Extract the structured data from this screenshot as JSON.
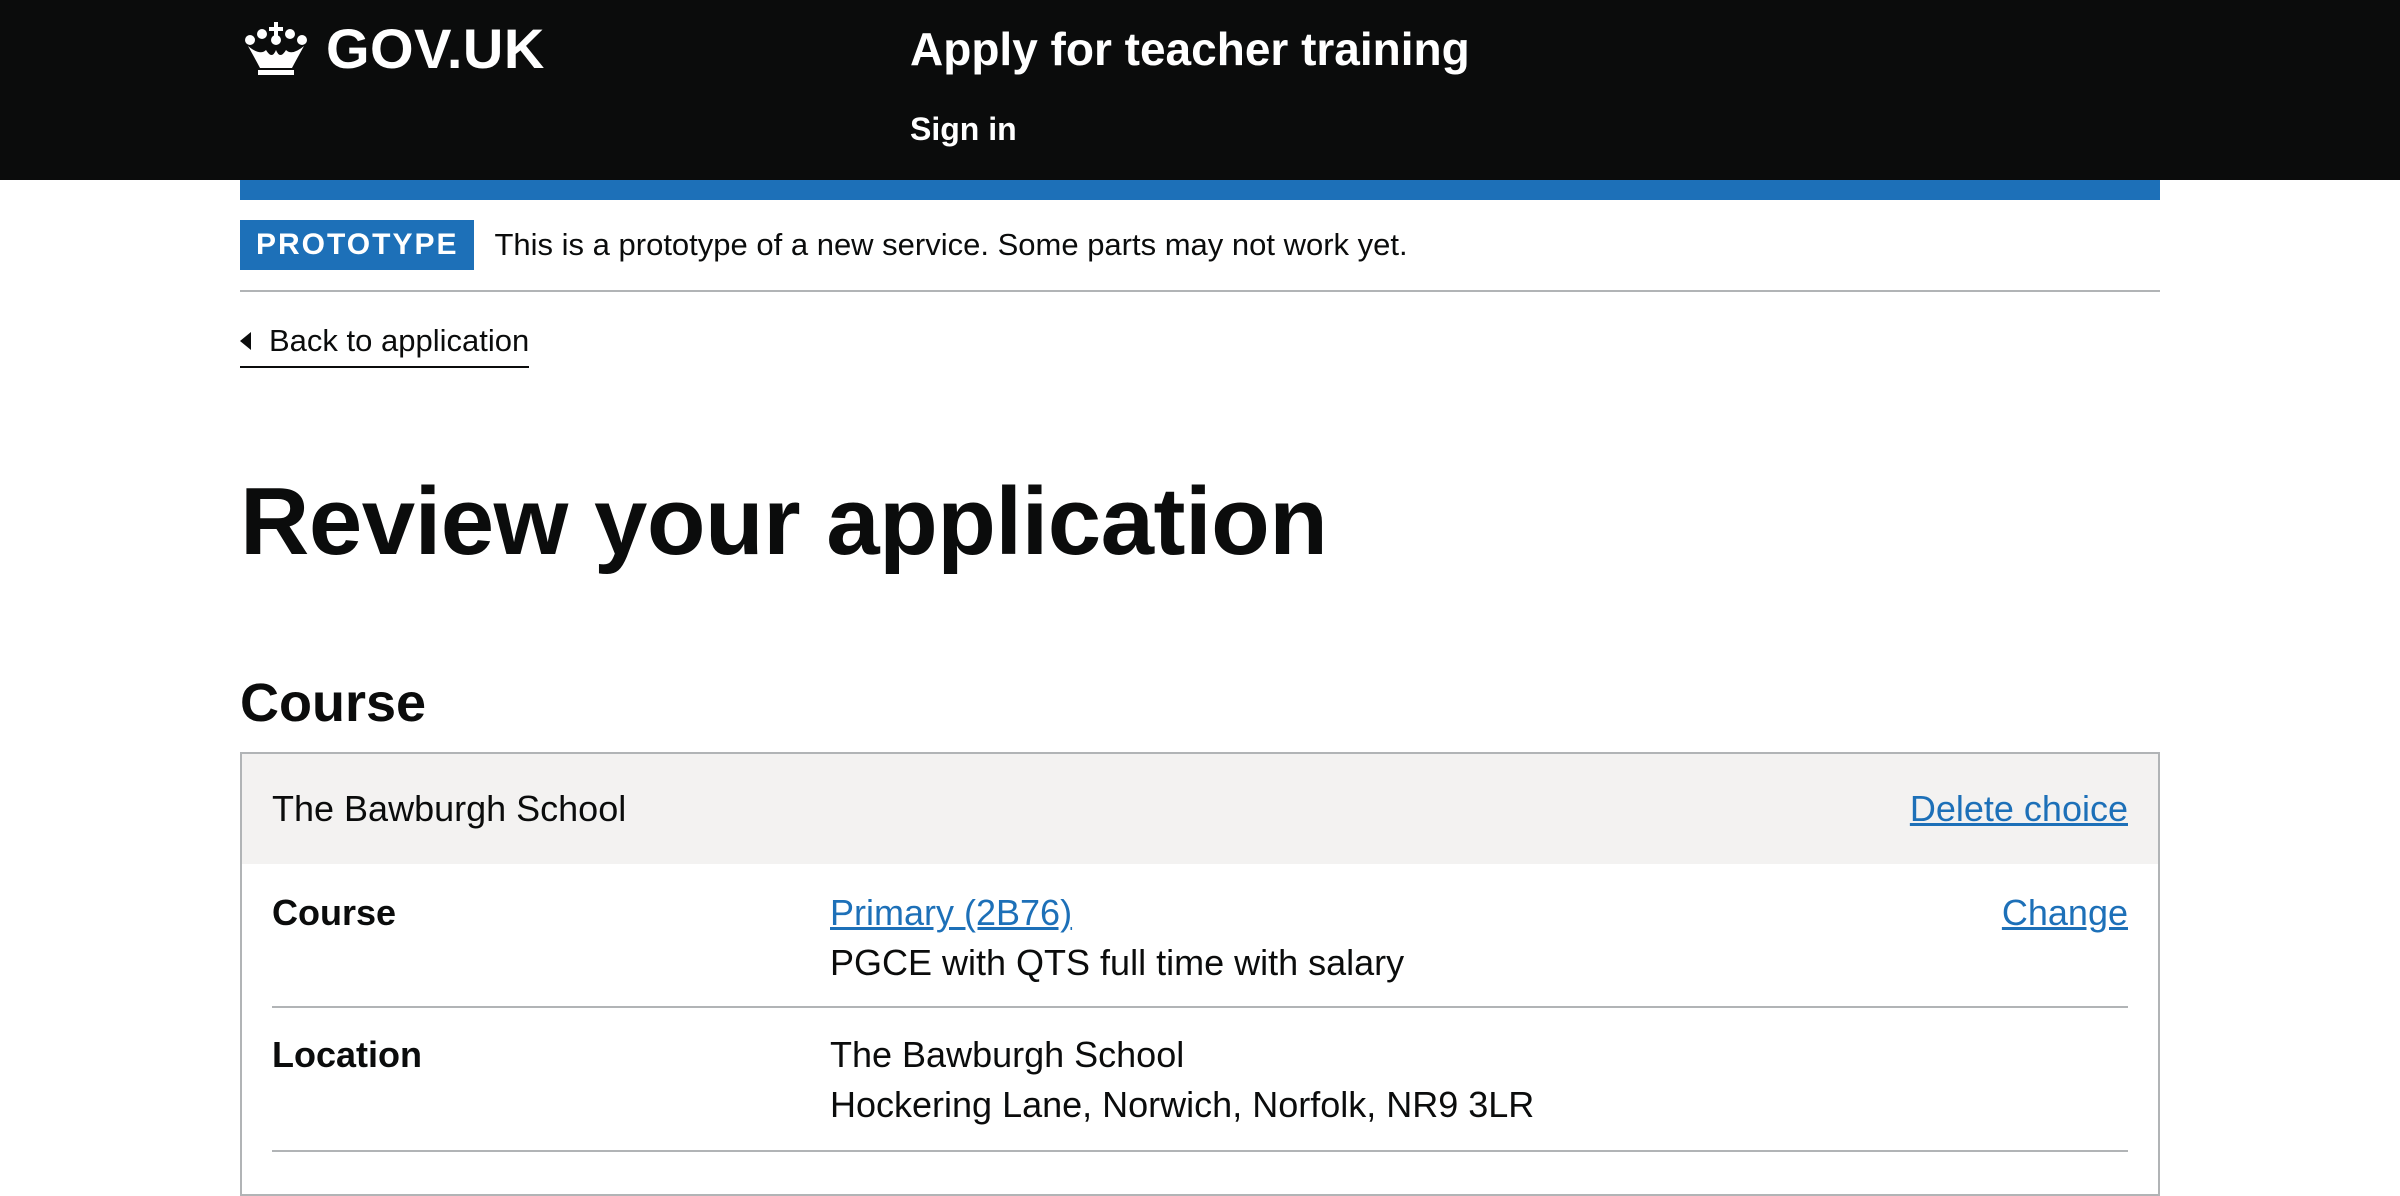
{
  "header": {
    "logo_text": "GOV.UK",
    "service_name": "Apply for teacher training",
    "sign_in": "Sign in"
  },
  "phase_banner": {
    "tag": "PROTOTYPE",
    "text": "This is a prototype of a new service. Some parts may not work yet."
  },
  "back_link": "Back to application",
  "page_title": "Review your application",
  "section_title": "Course",
  "choice_card": {
    "school": "The Bawburgh School",
    "delete_label": "Delete choice",
    "rows": [
      {
        "key": "Course",
        "value_link": "Primary (2B76)",
        "value_line2": "PGCE with QTS full time with salary",
        "action": "Change"
      },
      {
        "key": "Location",
        "value_line1": "The Bawburgh School",
        "value_line2": "Hockering Lane, Norwich, Norfolk, NR9 3LR"
      }
    ]
  },
  "colors": {
    "header_bg": "#0b0c0c",
    "brand_blue": "#1d70b8",
    "link": "#1d70b8",
    "card_header_bg": "#f3f2f1",
    "border": "#b1b4b6"
  },
  "icons": [
    "crown-icon",
    "back-chevron-icon"
  ]
}
